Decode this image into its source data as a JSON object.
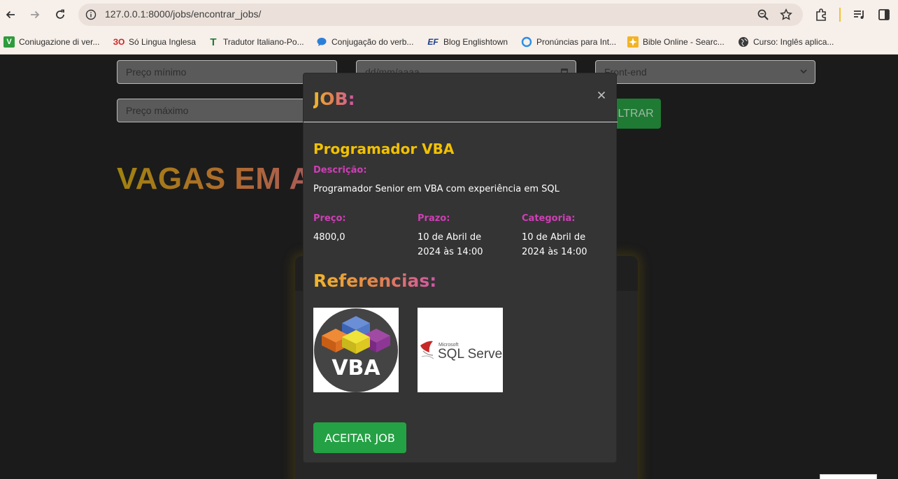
{
  "browser": {
    "url": "127.0.0.1:8000/jobs/encontrar_jobs/",
    "bookmarks": [
      {
        "label": "Coniugazione di ver...",
        "icon": "v-green-icon"
      },
      {
        "label": "Só Lingua Inglesa",
        "icon": "so-logo-icon"
      },
      {
        "label": "Tradutor Italiano-Po...",
        "icon": "t-green-icon"
      },
      {
        "label": "Conjugação do verb...",
        "icon": "chat-bubble-icon"
      },
      {
        "label": "Blog Englishtown",
        "icon": "ef-logo-icon"
      },
      {
        "label": "Pronúncias para Int...",
        "icon": "circle-icon"
      },
      {
        "label": "Bible Online - Searc...",
        "icon": "bible-icon"
      },
      {
        "label": "Curso: Inglês aplica...",
        "icon": "globe-icon"
      }
    ]
  },
  "filters": {
    "preco_minimo_placeholder": "Preço mínimo",
    "preco_maximo_placeholder": "Preço máximo",
    "date_placeholder": "dd/mm/aaaa",
    "categoria_selected": "Front-end",
    "filtrar_label": "ILTRAR"
  },
  "page": {
    "heading": "VAGAS EM A"
  },
  "modal": {
    "title": "JOB:",
    "job_name": "Programador VBA",
    "descricao_label": "Descrição:",
    "descricao": "Programador Senior em VBA com experiência em SQL",
    "preco_label": "Preço:",
    "preco": "4800,0",
    "prazo_label": "Prazo:",
    "prazo": "10 de Abril de 2024 às 14:00",
    "categoria_label": "Categoria:",
    "categoria": "10 de Abril de 2024 às 14:00",
    "referencias_label": "Referencias:",
    "references": [
      {
        "name": "vba-logo",
        "text": "VBA"
      },
      {
        "name": "sql-server-logo",
        "text": "SQL Server",
        "subtext": "Microsoft"
      }
    ],
    "accept_label": "ACEITAR JOB"
  }
}
